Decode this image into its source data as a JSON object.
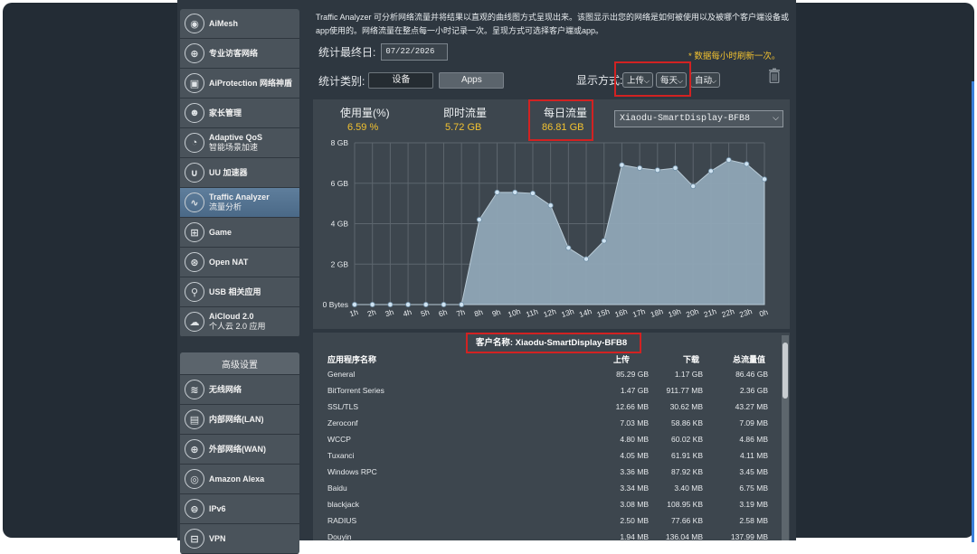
{
  "description": "Traffic Analyzer 可分析网络流量并将结果以直观的曲线图方式呈现出来。该图显示出您的网络是如何被使用以及被哪个客户端设备或app使用的。网络流量在整点每一小时记录一次。呈现方式可选择客户端或app。",
  "stat_end_label": "统计最终日:",
  "stat_end_date": "07/22/2026",
  "update_note": "* 数据每小时刷新一次。",
  "category_label": "统计类别:",
  "btn_device": "设备",
  "btn_apps": "Apps",
  "display_label": "显示方式:",
  "display_upload": "上传",
  "display_daily": "每天",
  "display_auto": "自动",
  "stats": {
    "usage_label": "使用量(%)",
    "usage_value": "6.59 %",
    "instant_label": "即时流量",
    "instant_value": "5.72 GB",
    "daily_label": "每日流量",
    "daily_value": "86.81 GB"
  },
  "device_selected": "Xiaodu-SmartDisplay-BFB8",
  "client_label": "客户名称: Xiaodu-SmartDisplay-BFB8",
  "table": {
    "headers": [
      "应用程序名称",
      "上传",
      "下载",
      "总流量值"
    ],
    "rows": [
      [
        "General",
        "85.29 GB",
        "1.17 GB",
        "86.46 GB"
      ],
      [
        "BitTorrent Series",
        "1.47 GB",
        "911.77 MB",
        "2.36 GB"
      ],
      [
        "SSL/TLS",
        "12.66 MB",
        "30.62 MB",
        "43.27 MB"
      ],
      [
        "Zeroconf",
        "7.03 MB",
        "58.86 KB",
        "7.09 MB"
      ],
      [
        "WCCP",
        "4.80 MB",
        "60.02 KB",
        "4.86 MB"
      ],
      [
        "Tuxanci",
        "4.05 MB",
        "61.91 KB",
        "4.11 MB"
      ],
      [
        "Windows RPC",
        "3.36 MB",
        "87.92 KB",
        "3.45 MB"
      ],
      [
        "Baidu",
        "3.34 MB",
        "3.40 MB",
        "6.75 MB"
      ],
      [
        "blackjack",
        "3.08 MB",
        "108.95 KB",
        "3.19 MB"
      ],
      [
        "RADIUS",
        "2.50 MB",
        "77.66 KB",
        "2.58 MB"
      ],
      [
        "Douyin",
        "1.94 MB",
        "136.04 MB",
        "137.99 MB"
      ]
    ]
  },
  "sidebar": {
    "items": [
      {
        "label": "AiMesh",
        "icon": "aimesh-icon",
        "glyph": "◉"
      },
      {
        "label": "专业访客网络",
        "icon": "globe-icon",
        "glyph": "⊕"
      },
      {
        "label": "AiProtection 网络神盾",
        "icon": "lock-icon",
        "glyph": "▣"
      },
      {
        "label": "家长管理",
        "icon": "family-icon",
        "glyph": "☻"
      },
      {
        "label": "Adaptive QoS",
        "sub": "智能场景加速",
        "icon": "gauge-icon",
        "glyph": "◔"
      },
      {
        "label": "UU 加速器",
        "icon": "uu-icon",
        "glyph": "∪"
      },
      {
        "label": "Traffic Analyzer",
        "sub": "流量分析",
        "icon": "pulse-icon",
        "glyph": "∿",
        "active": true
      },
      {
        "label": "Game",
        "icon": "gamepad-icon",
        "glyph": "⊞"
      },
      {
        "label": "Open NAT",
        "icon": "network-icon",
        "glyph": "⊛"
      },
      {
        "label": "USB 相关应用",
        "icon": "usb-icon",
        "glyph": "⚲"
      },
      {
        "label": "AiCloud 2.0",
        "sub": "个人云 2.0 应用",
        "icon": "cloud-icon",
        "glyph": "☁"
      }
    ],
    "advanced_header": "高级设置",
    "advanced_items": [
      {
        "label": "无线网络",
        "icon": "wifi-icon",
        "glyph": "≋"
      },
      {
        "label": "内部网络(LAN)",
        "icon": "lan-icon",
        "glyph": "▤"
      },
      {
        "label": "外部网络(WAN)",
        "icon": "wan-icon",
        "glyph": "⊕"
      },
      {
        "label": "Amazon Alexa",
        "icon": "alexa-icon",
        "glyph": "◎"
      },
      {
        "label": "IPv6",
        "icon": "ipv6-icon",
        "glyph": "⊜"
      },
      {
        "label": "VPN",
        "icon": "vpn-icon",
        "glyph": "⊟"
      }
    ]
  },
  "colors": {
    "accent": "#f2c230",
    "highlight": "#d22222",
    "area_fill": "#8fa6b6",
    "point": "#cfe3f2"
  },
  "chart_data": {
    "type": "area",
    "categories": [
      "1h",
      "2h",
      "3h",
      "4h",
      "5h",
      "6h",
      "7h",
      "8h",
      "9h",
      "10h",
      "11h",
      "12h",
      "13h",
      "14h",
      "15h",
      "16h",
      "17h",
      "18h",
      "19h",
      "20h",
      "21h",
      "22h",
      "23h",
      "0h"
    ],
    "values": [
      0,
      0,
      0,
      0,
      0,
      0,
      0,
      4.2,
      5.55,
      5.55,
      5.5,
      4.9,
      2.8,
      2.25,
      3.15,
      6.9,
      6.75,
      6.65,
      6.75,
      5.85,
      6.6,
      7.15,
      6.95,
      6.2
    ],
    "y_ticks": [
      "0 Bytes",
      "2 GB",
      "4 GB",
      "6 GB",
      "8 GB"
    ],
    "ylim": [
      0,
      8
    ],
    "yunit": "GB",
    "grid": true
  }
}
